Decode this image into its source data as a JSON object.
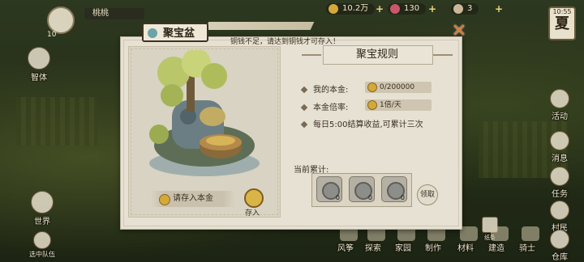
{
  "hud": {
    "level": "10",
    "player_name": "桃桃",
    "coins": "10.2万",
    "gems": "130",
    "tickets": "3",
    "season_time": "10:55",
    "season": "夏"
  },
  "side_left": [
    {
      "label": "智体"
    },
    {
      "label": "世界"
    },
    {
      "label": "选中队伍"
    }
  ],
  "side_right": [
    {
      "label": "活动"
    },
    {
      "label": "消息"
    },
    {
      "label": "任务"
    },
    {
      "label": "村民"
    },
    {
      "label": "仓库"
    }
  ],
  "bottom_nav": [
    "风筝",
    "探索",
    "家园",
    "制作",
    "材料",
    "建造",
    "骑士"
  ],
  "note_label": "纸条",
  "dialog": {
    "title": "聚宝盆",
    "warning": "铜钱不足，请达到铜钱才可存入！",
    "deposit_button": "请存入本金",
    "save_label": "存入",
    "rules_title": "聚宝规则",
    "principal_label": "我的本金:",
    "principal_value": "0/200000",
    "rate_label": "本金倍率:",
    "rate_value": "1倍/天",
    "schedule_text": "每日5:00结算收益,可累计三次",
    "accum_label": "当前累计:",
    "slots": [
      "0",
      "0",
      "0"
    ],
    "claim_label": "领取"
  },
  "colors": {
    "close": "#e07834",
    "coin": "#d4a93a"
  }
}
